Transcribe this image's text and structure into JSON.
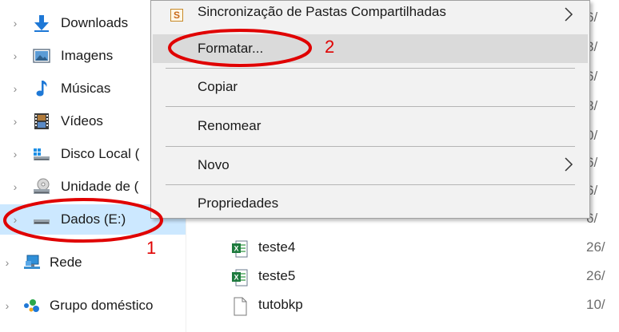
{
  "nav": {
    "items": [
      {
        "label": "Downloads",
        "icon": "download-arrow-icon"
      },
      {
        "label": "Imagens",
        "icon": "pictures-icon"
      },
      {
        "label": "Músicas",
        "icon": "music-note-icon"
      },
      {
        "label": "Vídeos",
        "icon": "film-icon"
      },
      {
        "label": "Disco Local (",
        "icon": "windows-drive-icon"
      },
      {
        "label": "Unidade de (",
        "icon": "optical-drive-icon"
      },
      {
        "label": "Dados (E:)",
        "icon": "drive-icon",
        "selected": true
      },
      {
        "label": "Rede",
        "icon": "network-icon"
      },
      {
        "label": "Grupo doméstico",
        "icon": "homegroup-icon"
      }
    ]
  },
  "context_menu": {
    "items": [
      {
        "label": "Sincronização de Pastas Compartilhadas",
        "icon": "sync-folders-icon",
        "submenu": true
      },
      {
        "label": "Formatar...",
        "hover": true
      },
      {
        "label": "Copiar"
      },
      {
        "label": "Renomear"
      },
      {
        "label": "Novo",
        "submenu": true
      },
      {
        "label": "Propriedades"
      }
    ]
  },
  "files": {
    "date_fragments_behind_menu": [
      "6/",
      "3/",
      "6/",
      "8/",
      "0/",
      "6/",
      "6/",
      "6/"
    ],
    "rows": [
      {
        "name": "teste4",
        "date": "26/",
        "icon": "excel-file-icon"
      },
      {
        "name": "teste5",
        "date": "26/",
        "icon": "excel-file-icon"
      },
      {
        "name": "tutobkp",
        "date": "10/",
        "icon": "blank-file-icon"
      }
    ]
  },
  "annotations": {
    "one": "1",
    "two": "2"
  },
  "colors": {
    "selection": "#cce8ff",
    "menu_bg": "#f2f2f2",
    "menu_hover": "#dadada",
    "annotation": "#e00000"
  }
}
